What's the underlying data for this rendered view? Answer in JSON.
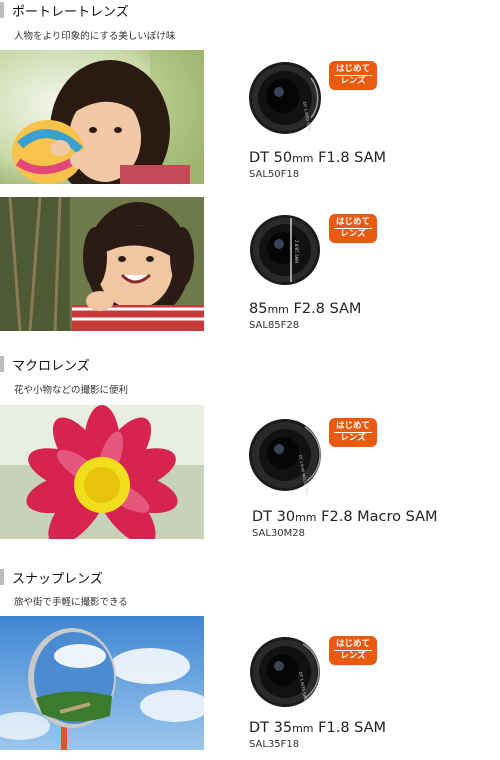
{
  "sections": [
    {
      "title": "ポートレートレンズ",
      "subtitle": "人物をより印象的にする美しいぼけ味"
    },
    {
      "title": "マクロレンズ",
      "subtitle": "花や小物などの撮影に便利"
    },
    {
      "title": "スナップレンズ",
      "subtitle": "旅や街で手軽に撮影できる"
    }
  ],
  "products": [
    {
      "name_prefix": "DT 50",
      "unit": "mm",
      "name_suffix": " F1.8 SAM",
      "code": "SAL50F18",
      "lens_text": "DT 1.8/50 SAM",
      "badge": [
        "はじめて",
        "レンズ"
      ]
    },
    {
      "name_prefix": "85",
      "unit": "mm",
      "name_suffix": " F2.8 SAM",
      "code": "SAL85F28",
      "lens_text": "2.8/85 SAM",
      "badge": [
        "はじめて",
        "レンズ"
      ]
    },
    {
      "name_prefix": "DT 30",
      "unit": "mm",
      "name_suffix": " F2.8 Macro SAM",
      "code": "SAL30M28",
      "lens_text": "DT 2.8/30 MACRO SAM",
      "badge": [
        "はじめて",
        "レンズ"
      ]
    },
    {
      "name_prefix": "DT 35",
      "unit": "mm",
      "name_suffix": " F1.8 SAM",
      "code": "SAL35F18",
      "lens_text": "DT 1.8/35 SAM",
      "badge": [
        "はじめて",
        "レンズ"
      ]
    }
  ],
  "colors": {
    "badge": "#e85a10",
    "section_bar": "#bdbdbd"
  }
}
